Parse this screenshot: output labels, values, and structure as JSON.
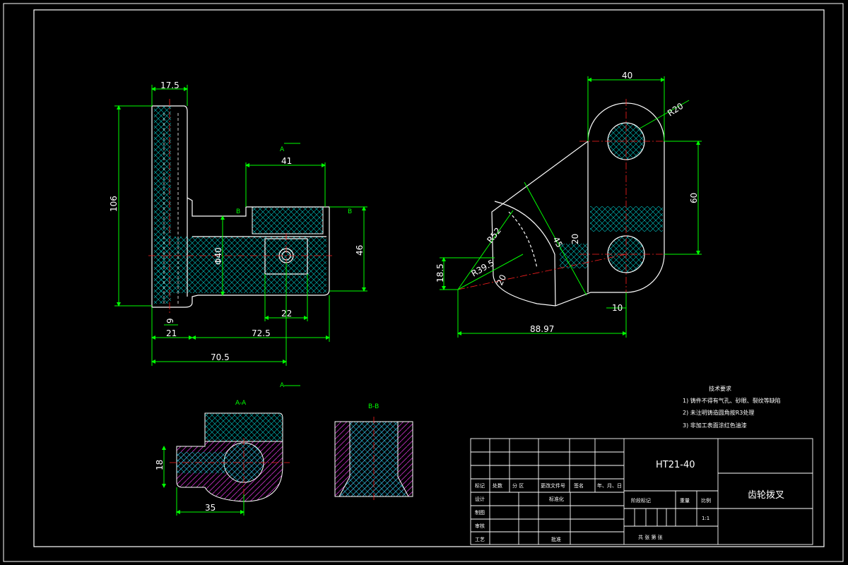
{
  "views": {
    "front": {
      "dims": {
        "d_17_5": "17.5",
        "d_106": "106",
        "d_41": "41",
        "d_phi40": "Φ40",
        "d_46": "46",
        "d_22": "22",
        "d_9": "9",
        "d_21": "21",
        "d_72_5": "72.5",
        "d_70_5": "70.5"
      },
      "section_marks": {
        "a_top": "A",
        "a_bottom": "A",
        "b_left": "B",
        "b_right": "B"
      }
    },
    "side": {
      "dims": {
        "d_40": "40",
        "d_r20": "R20",
        "d_60": "60",
        "d_r52": "R52",
        "d_45": "45",
        "d_20": "20",
        "d_r39_5": "R39.5",
        "d_18_5": "18.5",
        "d_20b": "20",
        "d_10": "10",
        "d_88_97": "88.97"
      }
    },
    "section_a": {
      "title": "A-A",
      "dims": {
        "d_18": "18",
        "d_35": "35"
      }
    },
    "section_b": {
      "title": "B-B"
    }
  },
  "notes": {
    "title": "技术要求",
    "items": [
      "1) 铸件不得有气孔、砂眼、裂纹等缺陷",
      "2) 未注明铸造圆角按R3处理",
      "3) 非加工表面涂红色油漆"
    ]
  },
  "title_block": {
    "part_code": "HT21-40",
    "part_name": "齿轮拨叉",
    "headers": [
      "标记",
      "处数",
      "分 区",
      "更改文件号",
      "签名",
      "年、月、日"
    ],
    "rows": [
      "设计",
      "制图",
      "审核",
      "工艺"
    ],
    "standardize": "标准化",
    "approve": "批准",
    "stage_mark": "阶段标记",
    "weight": "重量",
    "scale_label": "比例",
    "scale_value": "1:1",
    "sheets": "共   张   第   张"
  },
  "colors": {
    "background": "#000000",
    "outline": "#ffffff",
    "dimension": "#00ff00",
    "centerline": "#ff2020",
    "hatch": "#00c8c8",
    "section_fill": "#c832c8"
  }
}
